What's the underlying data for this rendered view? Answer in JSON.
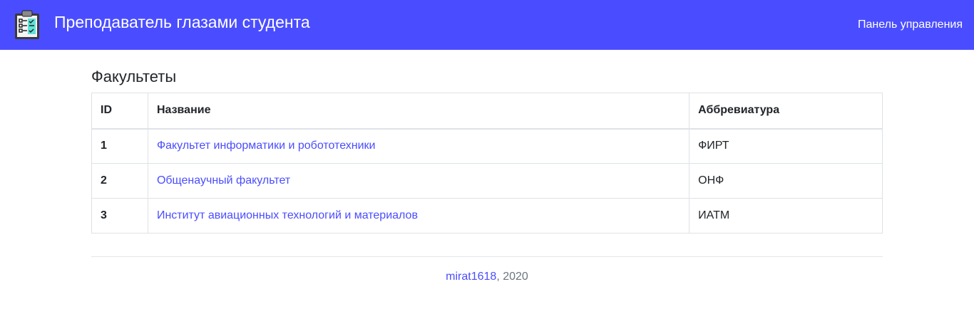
{
  "navbar": {
    "title": "Преподаватель глазами студента",
    "logo_icon": "clipboard-checklist-icon",
    "admin_link": "Панель управления",
    "background": "#4a4dff"
  },
  "page": {
    "heading": "Факультеты"
  },
  "table": {
    "headers": {
      "id": "ID",
      "name": "Название",
      "abbr": "Аббревиатура"
    },
    "rows": [
      {
        "id": "1",
        "name": "Факультет информатики и робототехники",
        "abbr": "ФИРТ"
      },
      {
        "id": "2",
        "name": "Общенаучный факультет",
        "abbr": "ОНФ"
      },
      {
        "id": "3",
        "name": "Институт авиационных технологий и материалов",
        "abbr": "ИАТМ"
      }
    ]
  },
  "footer": {
    "author": "mirat1618",
    "year": ", 2020"
  },
  "colors": {
    "accent": "#4a4dff",
    "link": "#4a4dff"
  }
}
